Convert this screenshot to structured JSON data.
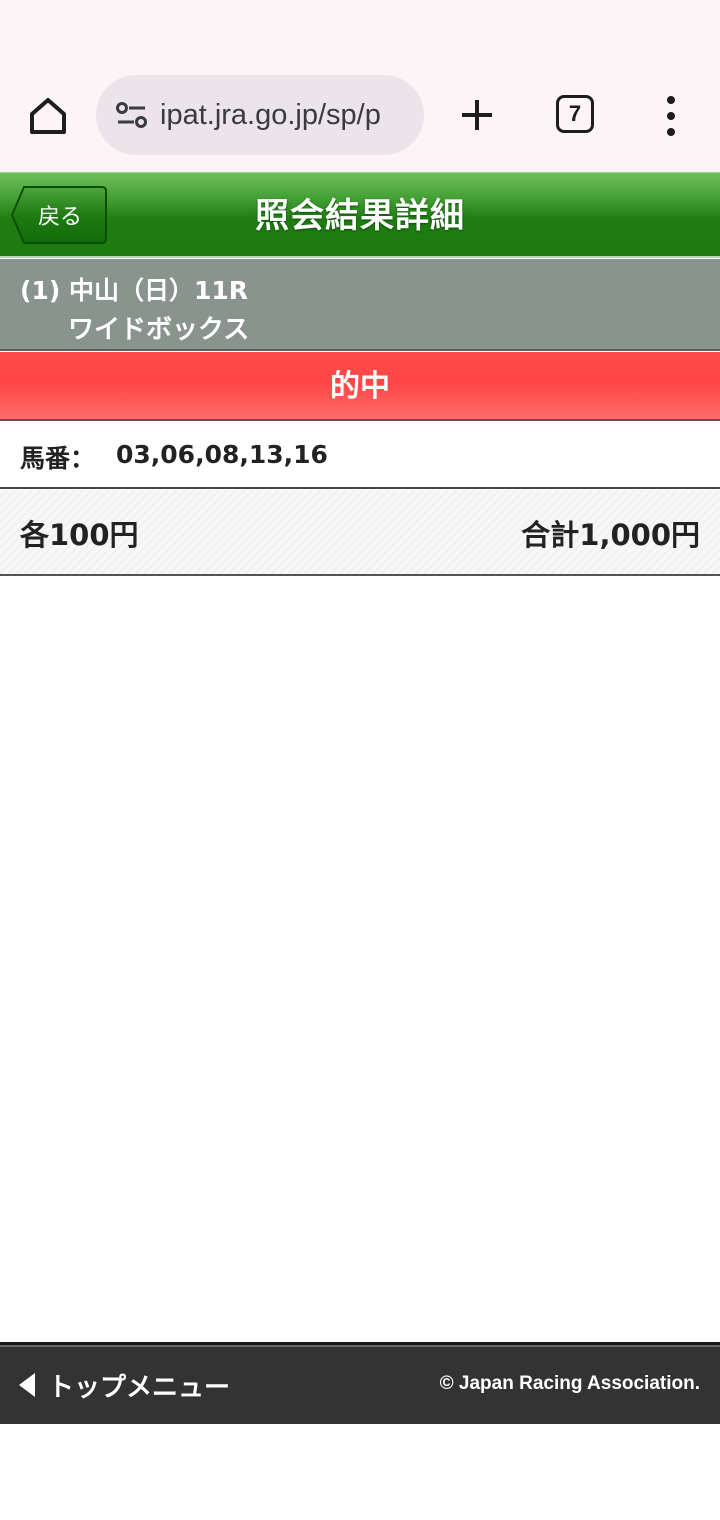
{
  "browser": {
    "url": "ipat.jra.go.jp/sp/p",
    "tab_count": "7"
  },
  "header": {
    "back_label": "戻る",
    "title": "照会結果詳細"
  },
  "race": {
    "line1": "(1) 中山（日）11R",
    "bet_type": "ワイドボックス"
  },
  "result": {
    "label": "的中"
  },
  "horses": {
    "label": "馬番：",
    "numbers": "03,06,08,13,16"
  },
  "amount": {
    "each": "各100円",
    "total": "合計1,000円"
  },
  "footer": {
    "top_menu_label": "トップメニュー",
    "copyright": "© Japan Racing Association."
  },
  "colors": {
    "header_green": "#1f7d12",
    "race_gray": "#8a948e",
    "hit_red": "#ff4a4a",
    "footer_dark": "#333333"
  },
  "icons": [
    "home-icon",
    "site-settings-icon",
    "plus-icon",
    "tab-count-icon",
    "more-vert-icon",
    "back-arrow-icon",
    "triangle-left-icon"
  ]
}
